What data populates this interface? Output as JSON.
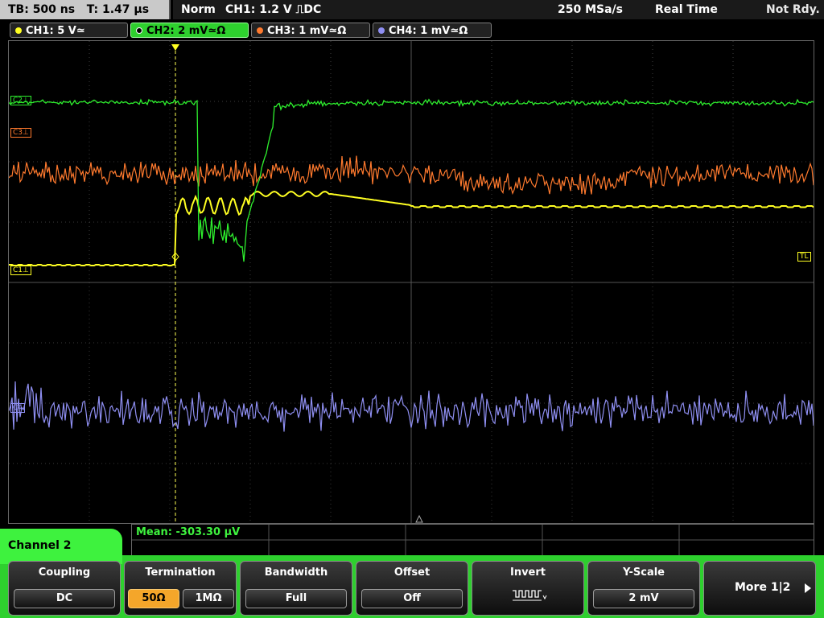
{
  "status": {
    "timebase": "TB: 500 ns",
    "trigger_time": "T: 1.47 µs",
    "mode": "Norm",
    "trigger_info": "CH1: 1.2 V ⎍DC",
    "sample_rate": "250 MSa/s",
    "acq_mode": "Real Time",
    "state": "Not Rdy."
  },
  "channels": [
    {
      "label": "CH1: 5 V≃",
      "color": "#ffff22",
      "active": false
    },
    {
      "label": "CH2: 2 mV≃Ω",
      "color": "#2ef02e",
      "active": true
    },
    {
      "label": "CH3: 1 mV≃Ω",
      "color": "#ff7a2e",
      "active": false
    },
    {
      "label": "CH4: 1 mV≃Ω",
      "color": "#8f8ff2",
      "active": false
    }
  ],
  "markers": {
    "c2": "C2⊥",
    "c3": "C3⊥",
    "c1": "C1⊥",
    "c4": "C4",
    "trigger_level": "TL"
  },
  "measurement": {
    "mean": "Mean: -303.30 µV"
  },
  "menu": {
    "channel_title": "Channel 2",
    "coupling": {
      "title": "Coupling",
      "value": "DC"
    },
    "termination": {
      "title": "Termination",
      "opt1": "50Ω",
      "opt2": "1MΩ"
    },
    "bandwidth": {
      "title": "Bandwidth",
      "value": "Full"
    },
    "offset": {
      "title": "Offset",
      "value": "Off"
    },
    "invert": {
      "title": "Invert"
    },
    "yscale": {
      "title": "Y-Scale",
      "value": "2 mV"
    },
    "more": {
      "label": "More 1|2"
    }
  }
}
